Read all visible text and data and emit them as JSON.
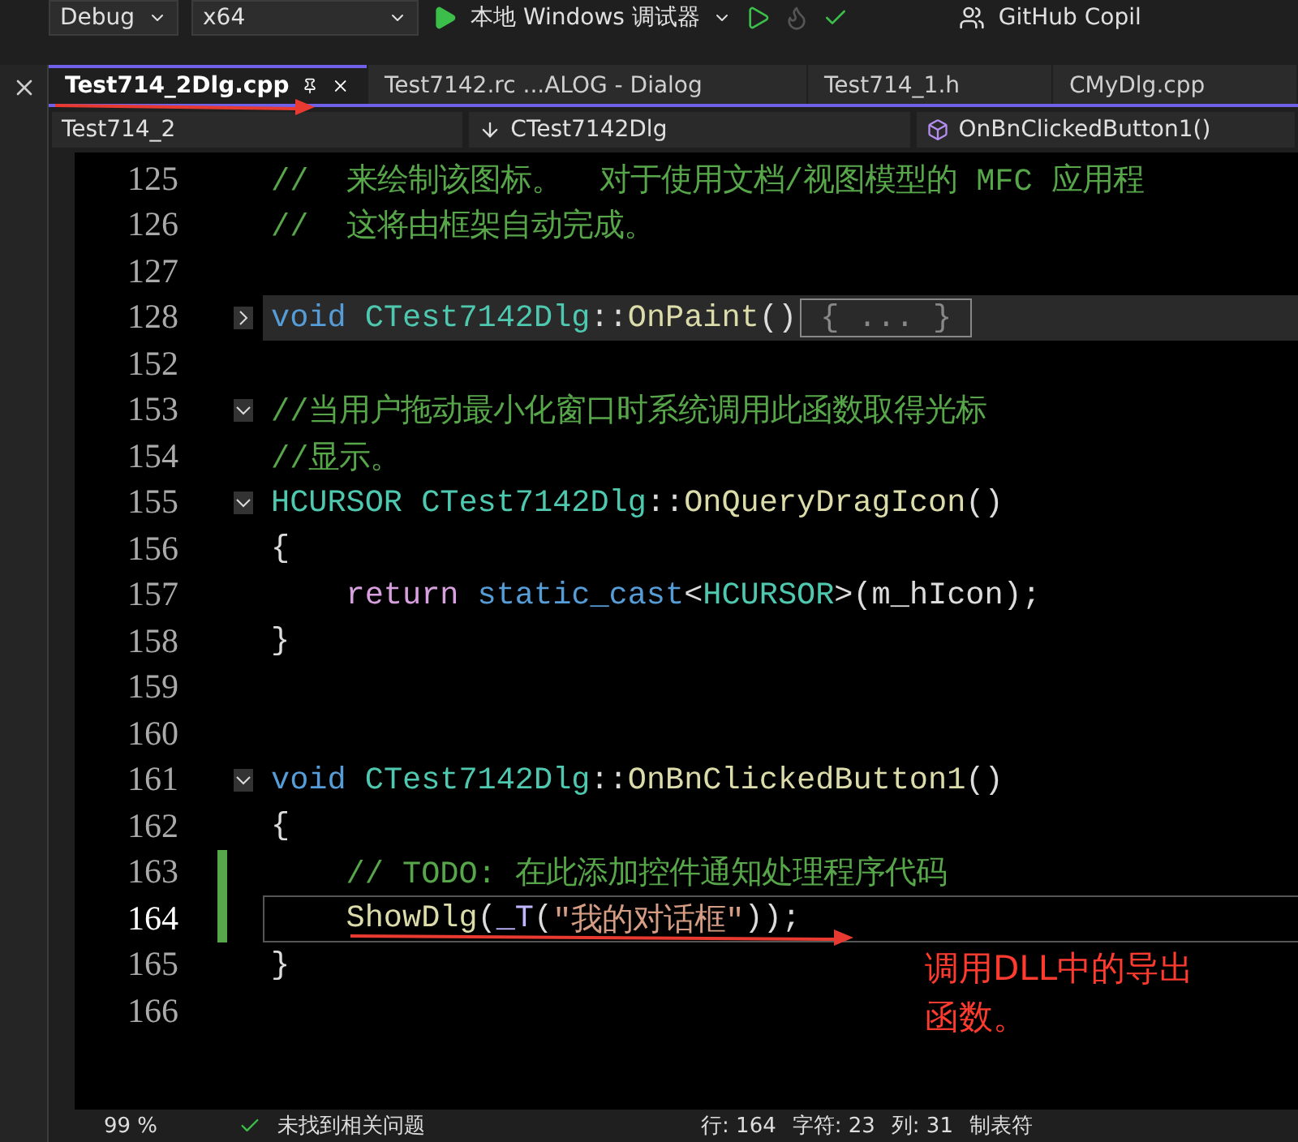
{
  "toolbar": {
    "configuration": "Debug",
    "platform": "x64",
    "debugger": "本地 Windows 调试器",
    "copilot": "GitHub Copil"
  },
  "tabs": [
    {
      "label": "Test714_2Dlg.cpp",
      "selected": true
    },
    {
      "label": "Test7142.rc ...ALOG - Dialog",
      "selected": false
    },
    {
      "label": "Test714_1.h",
      "selected": false
    },
    {
      "label": "CMyDlg.cpp",
      "selected": false
    }
  ],
  "navigation": {
    "project": "Test714_2",
    "class": "CTest7142Dlg",
    "member": "OnBnClickedButton1()"
  },
  "lines": [
    {
      "number": "125",
      "foldable": false,
      "collapsed": false,
      "current": false,
      "changed": false,
      "segments": [
        {
          "kind": "comment",
          "text": "//  来绘制该图标。  对于使用文档/视图模型的 MFC 应用程"
        }
      ]
    },
    {
      "number": "126",
      "foldable": false,
      "collapsed": false,
      "current": false,
      "changed": false,
      "segments": [
        {
          "kind": "comment",
          "text": "//  这将由框架自动完成。"
        }
      ]
    },
    {
      "number": "127",
      "foldable": false,
      "collapsed": false,
      "current": false,
      "changed": false
    },
    {
      "number": "128",
      "foldable": true,
      "collapsed": true,
      "current": false,
      "changed": false,
      "segments": [
        {
          "kind": "keyword",
          "text": "void"
        },
        {
          "kind": "type",
          "text": " CTest7142Dlg"
        },
        {
          "kind": "plain",
          "text": "::"
        },
        {
          "kind": "function",
          "text": "OnPaint"
        },
        {
          "kind": "plain",
          "text": "()"
        },
        {
          "kind": "collapsed",
          "text": " { ... } "
        }
      ]
    },
    {
      "number": "152",
      "foldable": false,
      "collapsed": false,
      "current": false,
      "changed": false
    },
    {
      "number": "153",
      "foldable": true,
      "collapsed": false,
      "current": false,
      "changed": false,
      "segments": [
        {
          "kind": "comment",
          "text": "//当用户拖动最小化窗口时系统调用此函数取得光标"
        }
      ]
    },
    {
      "number": "154",
      "foldable": false,
      "collapsed": false,
      "current": false,
      "changed": false,
      "segments": [
        {
          "kind": "comment",
          "text": "//显示。"
        }
      ]
    },
    {
      "number": "155",
      "foldable": true,
      "collapsed": false,
      "current": false,
      "changed": false,
      "segments": [
        {
          "kind": "type",
          "text": "HCURSOR"
        },
        {
          "kind": "type",
          "text": " CTest7142Dlg"
        },
        {
          "kind": "plain",
          "text": "::"
        },
        {
          "kind": "function",
          "text": "OnQueryDragIcon"
        },
        {
          "kind": "plain",
          "text": "()"
        }
      ]
    },
    {
      "number": "156",
      "foldable": false,
      "collapsed": false,
      "current": false,
      "changed": false,
      "segments": [
        {
          "kind": "plain",
          "text": "{"
        }
      ]
    },
    {
      "number": "157",
      "foldable": false,
      "collapsed": false,
      "current": false,
      "changed": false,
      "segments": [
        {
          "kind": "control",
          "text": "    return"
        },
        {
          "kind": "keyword",
          "text": " static_cast"
        },
        {
          "kind": "plain",
          "text": "<"
        },
        {
          "kind": "type",
          "text": "HCURSOR"
        },
        {
          "kind": "plain",
          "text": ">(m_hIcon);"
        }
      ]
    },
    {
      "number": "158",
      "foldable": false,
      "collapsed": false,
      "current": false,
      "changed": false,
      "segments": [
        {
          "kind": "plain",
          "text": "}"
        }
      ]
    },
    {
      "number": "159",
      "foldable": false,
      "collapsed": false,
      "current": false,
      "changed": false
    },
    {
      "number": "160",
      "foldable": false,
      "collapsed": false,
      "current": false,
      "changed": false
    },
    {
      "number": "161",
      "foldable": true,
      "collapsed": false,
      "current": false,
      "changed": false,
      "segments": [
        {
          "kind": "keyword",
          "text": "void"
        },
        {
          "kind": "type",
          "text": " CTest7142Dlg"
        },
        {
          "kind": "plain",
          "text": "::"
        },
        {
          "kind": "function",
          "text": "OnBnClickedButton1"
        },
        {
          "kind": "plain",
          "text": "()"
        }
      ]
    },
    {
      "number": "162",
      "foldable": false,
      "collapsed": false,
      "current": false,
      "changed": false,
      "segments": [
        {
          "kind": "plain",
          "text": "{"
        }
      ]
    },
    {
      "number": "163",
      "foldable": false,
      "collapsed": false,
      "current": false,
      "changed": true,
      "segments": [
        {
          "kind": "comment",
          "text": "    // TODO: 在此添加控件通知处理程序代码"
        }
      ]
    },
    {
      "number": "164",
      "foldable": false,
      "collapsed": false,
      "current": true,
      "changed": true,
      "segments": [
        {
          "kind": "function",
          "text": "    ShowDlg"
        },
        {
          "kind": "plain",
          "text": "("
        },
        {
          "kind": "macro",
          "text": "_T"
        },
        {
          "kind": "plain",
          "text": "("
        },
        {
          "kind": "string",
          "text": "\"我的对话框\""
        },
        {
          "kind": "plain",
          "text": "));"
        }
      ]
    },
    {
      "number": "165",
      "foldable": false,
      "collapsed": false,
      "current": false,
      "changed": false,
      "segments": [
        {
          "kind": "plain",
          "text": "}"
        }
      ]
    },
    {
      "number": "166",
      "foldable": false,
      "collapsed": false,
      "current": false,
      "changed": false
    }
  ],
  "annotation": {
    "text": "调用DLL中的导出函数。"
  },
  "status_bar": {
    "zoom": "99 %",
    "issues": "未找到相关问题",
    "line": "行: 164",
    "char": "字符: 23",
    "column": "列: 31",
    "indent": "制表符"
  }
}
